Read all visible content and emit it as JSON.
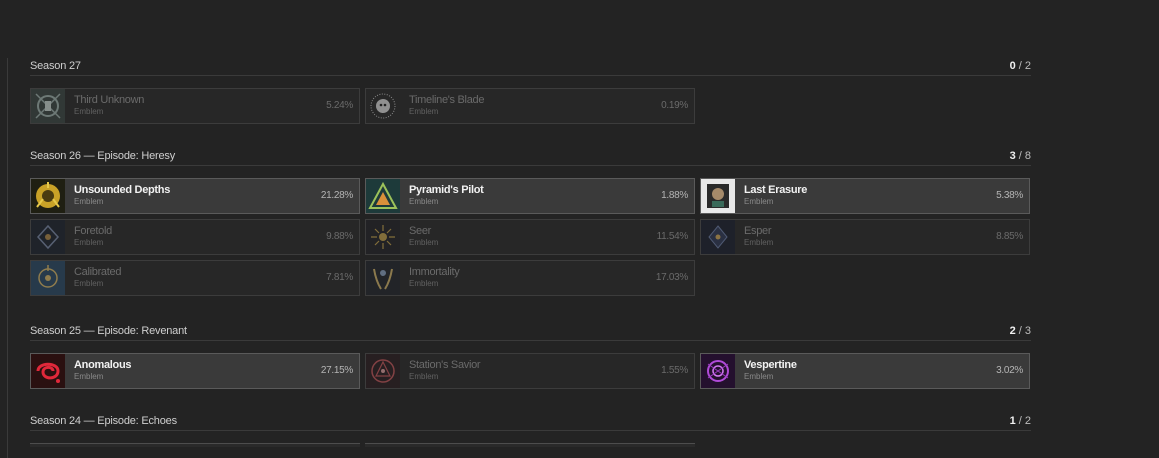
{
  "sections": [
    {
      "title": "Season 27",
      "count_got": "0",
      "count_total": "/ 2",
      "items": [
        {
          "name": "Third Unknown",
          "type": "Emblem",
          "pct": "5.24%",
          "icon": "third-unknown-emblem-icon",
          "got": false
        },
        {
          "name": "Timeline's Blade",
          "type": "Emblem",
          "pct": "0.19%",
          "icon": "timelines-blade-emblem-icon",
          "got": false
        }
      ]
    },
    {
      "title": "Season 26 — Episode: Heresy",
      "count_got": "3",
      "count_total": "/ 8",
      "items": [
        {
          "name": "Unsounded Depths",
          "type": "Emblem",
          "pct": "21.28%",
          "icon": "unsounded-depths-emblem-icon",
          "got": true
        },
        {
          "name": "Pyramid's Pilot",
          "type": "Emblem",
          "pct": "1.88%",
          "icon": "pyramids-pilot-emblem-icon",
          "got": true
        },
        {
          "name": "Last Erasure",
          "type": "Emblem",
          "pct": "5.38%",
          "icon": "last-erasure-emblem-icon",
          "got": true
        },
        {
          "name": "Foretold",
          "type": "Emblem",
          "pct": "9.88%",
          "icon": "foretold-emblem-icon",
          "got": false
        },
        {
          "name": "Seer",
          "type": "Emblem",
          "pct": "11.54%",
          "icon": "seer-emblem-icon",
          "got": false
        },
        {
          "name": "Esper",
          "type": "Emblem",
          "pct": "8.85%",
          "icon": "esper-emblem-icon",
          "got": false
        },
        {
          "name": "Calibrated",
          "type": "Emblem",
          "pct": "7.81%",
          "icon": "calibrated-emblem-icon",
          "got": false
        },
        {
          "name": "Immortality",
          "type": "Emblem",
          "pct": "17.03%",
          "icon": "immortality-emblem-icon",
          "got": false
        }
      ]
    },
    {
      "title": "Season 25 — Episode: Revenant",
      "count_got": "2",
      "count_total": "/ 3",
      "items": [
        {
          "name": "Anomalous",
          "type": "Emblem",
          "pct": "27.15%",
          "icon": "anomalous-emblem-icon",
          "got": true
        },
        {
          "name": "Station's Savior",
          "type": "Emblem",
          "pct": "1.55%",
          "icon": "stations-savior-emblem-icon",
          "got": false
        },
        {
          "name": "Vespertine",
          "type": "Emblem",
          "pct": "3.02%",
          "icon": "vespertine-emblem-icon",
          "got": true
        }
      ]
    },
    {
      "title": "Season 24 — Episode: Echoes",
      "count_got": "1",
      "count_total": "/ 2",
      "items": []
    }
  ],
  "colors": {
    "background": "#232323",
    "card_owned": "#3a3a3a",
    "card_missing": "#2a2a2a",
    "border": "#4d4d4d"
  }
}
